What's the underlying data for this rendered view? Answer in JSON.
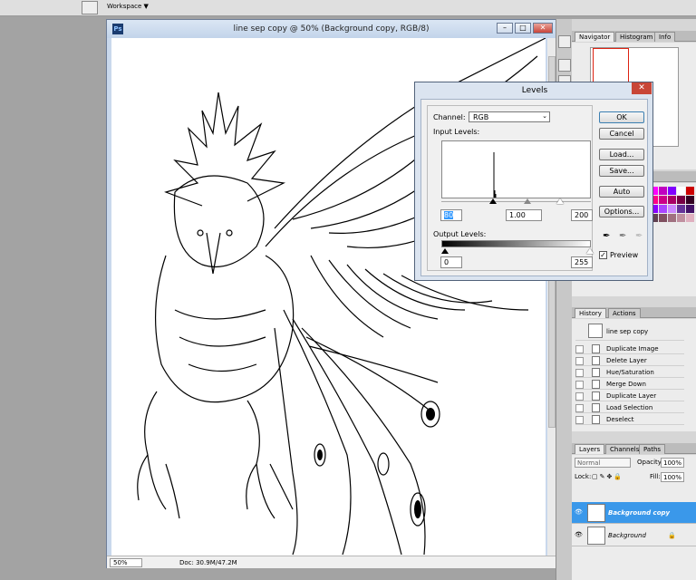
{
  "options_bar": {
    "workspace_label": "Workspace ▼"
  },
  "document": {
    "title": "line sep copy @ 50% (Background copy, RGB/8)",
    "ps_badge": "Ps",
    "zoom": "50%",
    "doc_info": "Doc: 30.9M/47.2M",
    "window_buttons": {
      "min": "–",
      "max": "□",
      "close": "✕"
    }
  },
  "levels": {
    "title": "Levels",
    "close": "✕",
    "channel_label": "Channel:",
    "channel_value": "RGB",
    "input_label": "Input Levels:",
    "input_black": "80",
    "input_gamma": "1.00",
    "input_white": "200",
    "output_label": "Output Levels:",
    "output_black": "0",
    "output_white": "255",
    "buttons": {
      "ok": "OK",
      "cancel": "Cancel",
      "load": "Load...",
      "save": "Save...",
      "auto": "Auto",
      "options": "Options..."
    },
    "preview_label": "Preview",
    "preview_checked": "✓"
  },
  "navigator_panel": {
    "tabs": [
      "Navigator",
      "Histogram",
      "Info"
    ]
  },
  "history_panel": {
    "tabs": [
      "History",
      "Actions"
    ],
    "snapshot": "line sep copy",
    "items": [
      "Duplicate Image",
      "Delete Layer",
      "Hue/Saturation",
      "Merge Down",
      "Duplicate Layer",
      "Load Selection",
      "Deselect"
    ]
  },
  "layers_panel": {
    "tabs": [
      "Layers",
      "Channels",
      "Paths"
    ],
    "blend_mode": "Normal",
    "opacity_label": "Opacity:",
    "opacity_value": "100%",
    "lock_label": "Lock:",
    "fill_label": "Fill:",
    "fill_value": "100%",
    "layers": [
      {
        "name": "Background copy",
        "selected": true
      },
      {
        "name": "Background",
        "selected": false
      }
    ]
  },
  "colors": {
    "accent_selected": "#3a98ea",
    "dialog_close": "#c84637"
  },
  "swatches": [
    [
      "#000000",
      "#3a3a3a",
      "#ff0000",
      "#ff00ff",
      "#c000c0",
      "#8000ff",
      "#ffffff",
      "#cc0000"
    ],
    [
      "#440000",
      "#880000",
      "#cc0044",
      "#ff0088",
      "#cc0088",
      "#aa0066",
      "#770044",
      "#330022"
    ],
    [
      "#220044",
      "#440088",
      "#6600cc",
      "#8800ff",
      "#aa44ff",
      "#cc88ff",
      "#663399",
      "#441166"
    ],
    [
      "#a06080",
      "#c080a0",
      "#e0a0c0",
      "#604050",
      "#805060",
      "#a07080",
      "#c090a0",
      "#e0b0c0"
    ]
  ]
}
